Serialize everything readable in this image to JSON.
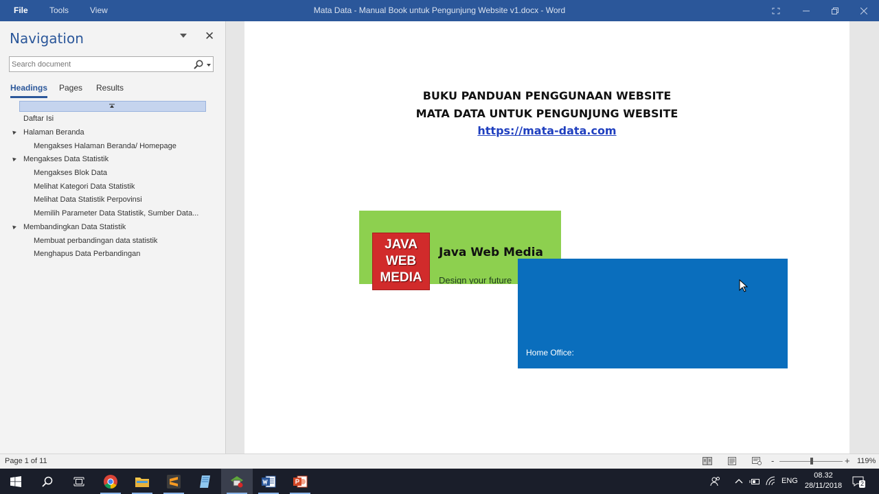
{
  "titlebar": {
    "menu_file": "File",
    "menu_tools": "Tools",
    "menu_view": "View",
    "document_title": "Mata Data - Manual Book untuk Pengunjung Website v1.docx  -  Word"
  },
  "navigation": {
    "title": "Navigation",
    "search_placeholder": "Search document",
    "tabs": [
      "Headings",
      "Pages",
      "Results"
    ],
    "active_tab": "Headings",
    "headings": [
      {
        "label": "Daftar Isi",
        "level": 1,
        "expandable": false
      },
      {
        "label": "Halaman Beranda",
        "level": 1,
        "expandable": true
      },
      {
        "label": "Mengakses Halaman Beranda/ Homepage",
        "level": 2,
        "expandable": false
      },
      {
        "label": "Mengakses Data Statistik",
        "level": 1,
        "expandable": true
      },
      {
        "label": "Mengakses Blok Data",
        "level": 2,
        "expandable": false
      },
      {
        "label": "Melihat Kategori Data Statistik",
        "level": 2,
        "expandable": false
      },
      {
        "label": "Melihat Data Statistik Perpovinsi",
        "level": 2,
        "expandable": false
      },
      {
        "label": "Memilih  Parameter Data Statistik, Sumber Data...",
        "level": 2,
        "expandable": false
      },
      {
        "label": "Membandingkan Data Statistik",
        "level": 1,
        "expandable": true
      },
      {
        "label": "Membuat perbandingan data statistik",
        "level": 2,
        "expandable": false
      },
      {
        "label": "Menghapus Data Perbandingan",
        "level": 2,
        "expandable": false
      }
    ]
  },
  "document": {
    "heading_line1": "BUKU PANDUAN PENGGUNAAN WEBSITE",
    "heading_line2": "MATA DATA UNTUK PENGUNJUNG WEBSITE",
    "link": "https://mata-data.com",
    "logo_lines": [
      "JAVA",
      "WEB",
      "MEDIA"
    ],
    "company_name": "Java Web Media",
    "tagline": "Design your future",
    "home_office_label": "Home Office:",
    "colors": {
      "green_card": "#8dd04f",
      "blue_card": "#0a6ebd",
      "logo": "#d12b2b",
      "link": "#1f3fbf"
    }
  },
  "statusbar": {
    "page_count": "Page 1 of 11",
    "zoom_minus": "-",
    "zoom_plus": "+",
    "zoom_level": "119%"
  },
  "taskbar": {
    "language": "ENG",
    "time": "08.32",
    "date": "28/11/2018",
    "notification_count": "2"
  }
}
